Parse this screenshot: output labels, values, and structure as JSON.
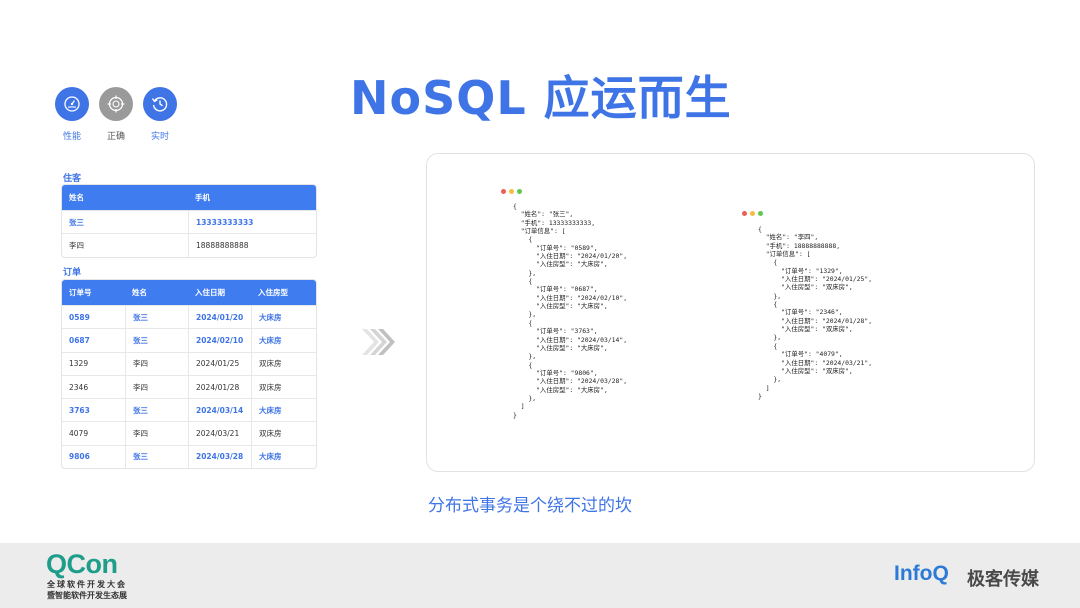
{
  "title": "NoSQL 应运而生",
  "features": [
    {
      "label": "性能",
      "icon": "gauge-icon",
      "color": "#3f74e6"
    },
    {
      "label": "正确",
      "icon": "target-icon",
      "color": "#9a9a9a"
    },
    {
      "label": "实时",
      "icon": "history-clock-icon",
      "color": "#3f74e6"
    }
  ],
  "guests": {
    "label": "住客",
    "headers": [
      "姓名",
      "手机"
    ],
    "rows": [
      [
        "张三",
        "13333333333"
      ],
      [
        "李四",
        "18888888888"
      ]
    ]
  },
  "orders": {
    "label": "订单",
    "headers": [
      "订单号",
      "姓名",
      "入住日期",
      "入住房型"
    ],
    "rows": [
      [
        "0589",
        "张三",
        "2024/01/20",
        "大床房"
      ],
      [
        "0687",
        "张三",
        "2024/02/10",
        "大床房"
      ],
      [
        "1329",
        "李四",
        "2024/01/25",
        "双床房"
      ],
      [
        "2346",
        "李四",
        "2024/01/28",
        "双床房"
      ],
      [
        "3763",
        "张三",
        "2024/03/14",
        "大床房"
      ],
      [
        "4079",
        "李四",
        "2024/03/21",
        "双床房"
      ],
      [
        "9806",
        "张三",
        "2024/03/28",
        "大床房"
      ]
    ]
  },
  "code_left": "{\n  \"姓名\": \"张三\",\n  \"手机\": 13333333333,\n  \"订单信息\": [\n    {\n      \"订单号\": \"0589\",\n      \"入住日期\": \"2024/01/20\",\n      \"入住房型\": \"大床房\",\n    },\n    {\n      \"订单号\": \"0687\",\n      \"入住日期\": \"2024/02/10\",\n      \"入住房型\": \"大床房\",\n    },\n    {\n      \"订单号\": \"3763\",\n      \"入住日期\": \"2024/03/14\",\n      \"入住房型\": \"大床房\",\n    },\n    {\n      \"订单号\": \"9806\",\n      \"入住日期\": \"2024/03/28\",\n      \"入住房型\": \"大床房\",\n    },\n  ]\n}",
  "code_right": "{\n  \"姓名\": \"李四\",\n  \"手机\": 18888888888,\n  \"订单信息\": [\n    {\n      \"订单号\": \"1329\",\n      \"入住日期\": \"2024/01/25\",\n      \"入住房型\": \"双床房\",\n    },\n    {\n      \"订单号\": \"2346\",\n      \"入住日期\": \"2024/01/28\",\n      \"入住房型\": \"双床房\",\n    },\n    {\n      \"订单号\": \"4079\",\n      \"入住日期\": \"2024/03/21\",\n      \"入住房型\": \"双床房\",\n    },\n  ]\n}",
  "caption": "分布式事务是个绕不过的坎",
  "footer": {
    "qcon_logo": "QCon",
    "qcon_sub1": "全球软件开发大会",
    "qcon_sub2": "暨智能软件开发生态展",
    "infoq_logo": "InfoQ",
    "infoq_cn": "极客传媒"
  },
  "colors": {
    "accent": "#3f74e6",
    "table_header": "#3f7cf0",
    "qcon": "#1e9e8a",
    "infoq": "#2c7ad6"
  }
}
